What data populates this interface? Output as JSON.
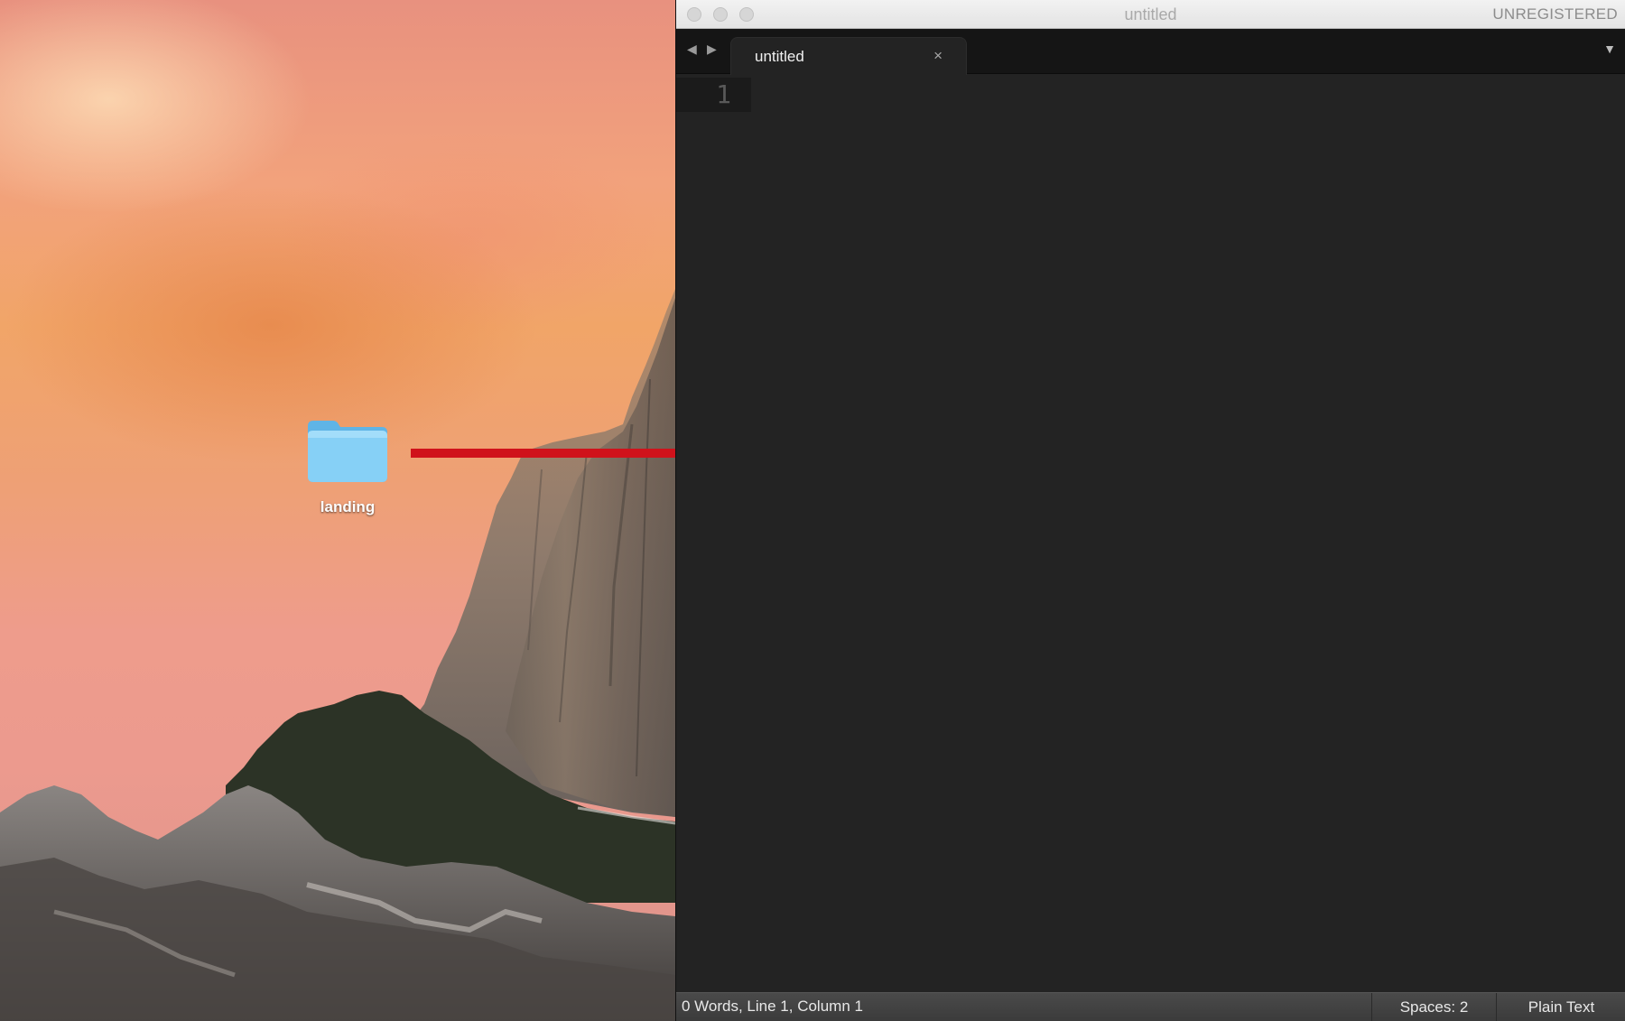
{
  "desktop": {
    "folder": {
      "label": "landing",
      "icon": "folder-icon",
      "color": "#7cc9f4"
    },
    "drag_arrow_color": "#d0121b"
  },
  "window": {
    "title": "untitled",
    "registration": "UNREGISTERED",
    "traffic_lights": [
      "close",
      "minimize",
      "zoom"
    ]
  },
  "tabs": {
    "prev_icon": "◀",
    "next_icon": "▶",
    "items": [
      {
        "label": "untitled",
        "close_icon": "×"
      }
    ],
    "menu_icon": "▼"
  },
  "editor": {
    "line_numbers": [
      "1"
    ],
    "content": ""
  },
  "statusbar": {
    "info": "0 Words, Line 1, Column 1",
    "indentation": "Spaces: 2",
    "syntax": "Plain Text"
  }
}
